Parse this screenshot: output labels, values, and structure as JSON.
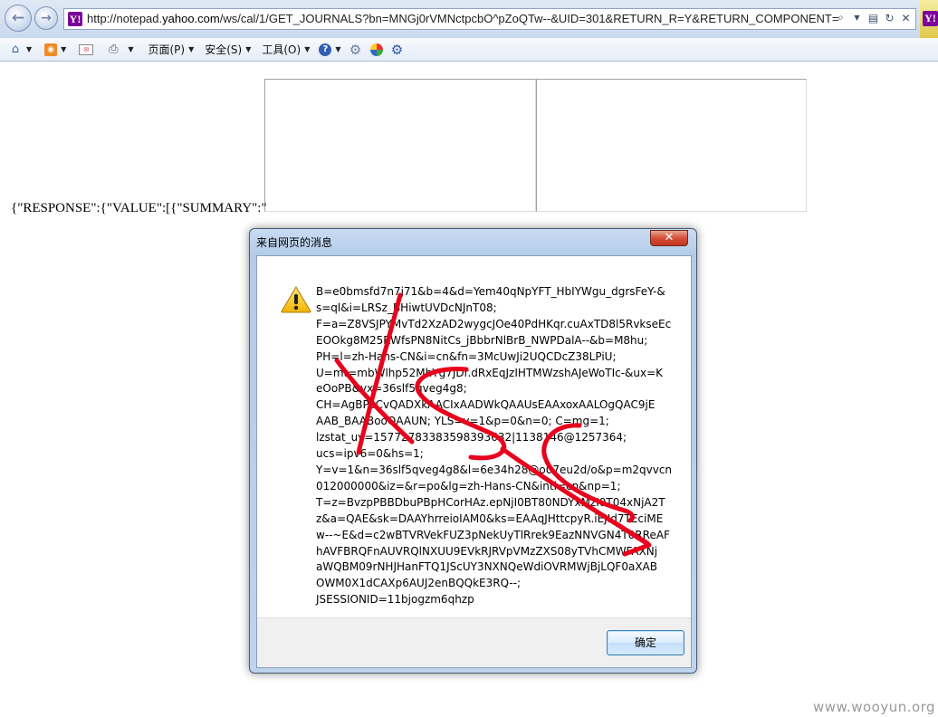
{
  "browser": {
    "favicon_letter": "Y!",
    "url_prefix": "http://notepad.",
    "url_domain": "yahoo.com",
    "url_rest": "/ws/cal/1/GET_JOURNALS?bn=MNGj0rVMNctpcbO^pZoQTw--&UID=301&RETURN_R=Y&RETURN_COMPONENT=tr",
    "toolbar": {
      "page_menu": "页面(P)",
      "safety_menu": "安全(S)",
      "tools_menu": "工具(O)"
    }
  },
  "page": {
    "json_text": "{\"RESPONSE\":{\"VALUE\":[{\"SUMMARY\":\""
  },
  "dialog": {
    "title": "来自网页的消息",
    "close_glyph": "✕",
    "message_lines": [
      "B=e0bmsfd7n7j71&b=4&d=Yem40qNpYFT_HbIYWgu_dgrsFeY-&",
      "s=ql&i=LRSz_BHiwtUVDcNJnT08;",
      "F=a=Z8VSJPYMvTd2XzAD2wygcJOe40PdHKqr.cuAxTD8l5RvkseEc",
      "EOOkg8M25RWfsPN8NitCs_jBbbrNlBrB_NWPDalA--&b=M8hu;",
      "PH=l=zh-Hans-CN&i=cn&fn=3McUwJi2UQCDcZ38LPiU;",
      "U=mt=mbWlhp52MhYg7JDr.dRxEqJzIHTMWzshAJeWoTIc-&ux=K",
      "eOoPB&yx=36slf5qveg4g8;",
      "CH=AgBPoCvQADXkAACIxAADWkQAAUsEAAxoxAALOgQAC9jE",
      "AAB_BAABooQAAUN; YLS=v=1&p=0&n=0; C=mg=1;",
      "lzstat_uv=15772783383598393632|1138146@1257364;",
      "ucs=ipv6=0&hs=1;",
      "Y=v=1&n=36slf5qveg4g8&l=6e34h28@o07eu2d/o&p=m2qvvcn",
      "012000000&iz=&r=po&lg=zh-Hans-CN&intl=cn&np=1;",
      "T=z=BvzpPBBDbuPBpHCorHAz.epNjI0BT80NDYxMzI0T04xNjA2T",
      "z&a=QAE&sk=DAAYhrreioIAM0&ks=EAAqJHttcpyR.iEJId7TEciME",
      "w--~E&d=c2wBTVRVekFUZ3pNekUyTlRrek9EazNNVGN4T0RReAF",
      "hAVFBRQFnAUVRQlNXUU9EVkRJRVpVMzZXS08yTVhCMWFAXNj",
      "aWQBM09rNHJHanFTQ1JScUY3NXNQeWdiOVRMWjBjLQF0aXAB",
      "OWM0X1dCAXp6AUJ2enBQQkE3RQ--;",
      "JSESSIONID=11bjogzm6qhzp"
    ],
    "ok_label": "确定"
  },
  "watermark": "www.wooyun.org",
  "colors": {
    "scribble": "#e8001c",
    "dialog_frame": "#b9cfeb",
    "ok_border": "#3c7fb1"
  }
}
